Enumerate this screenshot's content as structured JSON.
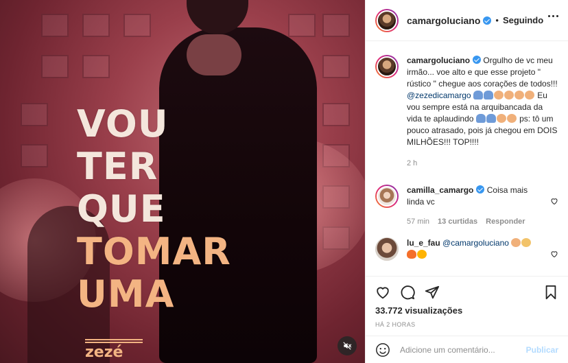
{
  "media": {
    "overlay_lines": [
      "VOU",
      "TER",
      "QUE",
      "TOMAR",
      "UMA"
    ],
    "brand": "zezé",
    "mute_icon": "mute-icon"
  },
  "header": {
    "username": "camargoluciano",
    "separator": "•",
    "follow_label": "Seguindo",
    "more_icon": "more-options-icon"
  },
  "caption": {
    "username": "camargoluciano",
    "text_1": "Orgulho de vc meu irmão... voe alto e que esse projeto \" rústico \" chegue aos corações de todos!!! ",
    "mention": "@zezedicamargo",
    "text_2": " Eu vou sempre está na arquibancada da vida te aplaudindo ",
    "text_3": " ps: tô um pouco atrasado, pois já chegou em DOIS MILHÕES!!! TOP!!!!",
    "time": "2 h"
  },
  "comments": [
    {
      "username": "camilla_camargo",
      "text": "Coisa mais linda vc",
      "time": "57 min",
      "likes": "13 curtidas",
      "reply": "Responder"
    },
    {
      "username": "lu_e_fau",
      "mention": "@camargoluciano"
    }
  ],
  "actions": {
    "views": "33.772 visualizações",
    "posted": "HÁ 2 HORAS"
  },
  "add_comment": {
    "placeholder": "Adicione um comentário...",
    "publish": "Publicar"
  },
  "colors": {
    "verified": "#3897f0",
    "link": "#00376b",
    "publish_disabled": "#b3dbff"
  }
}
